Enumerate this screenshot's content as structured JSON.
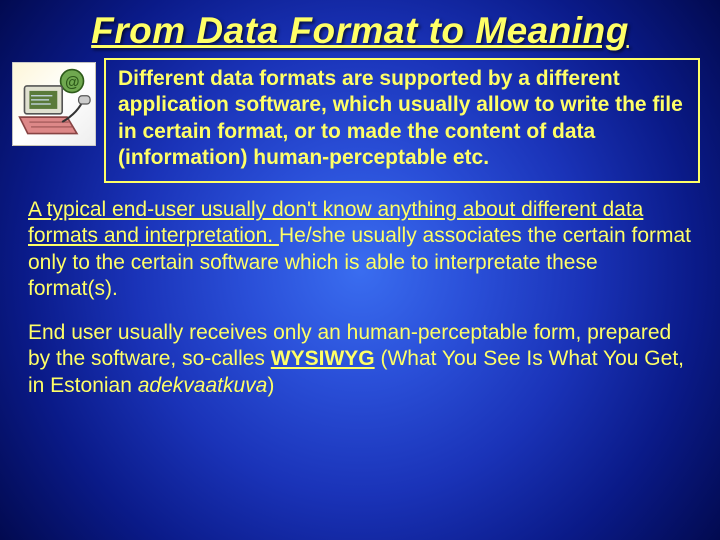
{
  "title": "From Data Format to Meaning",
  "box_text": "Different data formats are supported by a different application software, which usually allow to write the file in certain format, or to made the content of data (information) human-perceptable etc.",
  "p1_a": "A typical end-user usually don't know anything about different data formats and interpretation. ",
  "p1_b": "He/she usually associates the certain format only to the certain software which is able to interpretate these format(s).",
  "p2_a": "End user usually receives only an human-perceptable form, prepared by the software, so-calles ",
  "p2_wysiwyg": "WYSIWYG",
  "p2_b": " (What You See Is What You Get, in Estonian ",
  "p2_c": "adekvaatkuva",
  "p2_d": ")"
}
